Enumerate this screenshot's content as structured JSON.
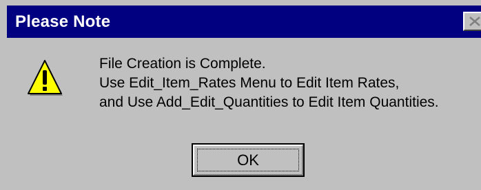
{
  "dialog": {
    "title": "Please Note",
    "message_lines": [
      "File Creation is Complete.",
      "Use Edit_Item_Rates Menu to Edit Item Rates,",
      "and Use Add_Edit_Quantities to Edit Item Quantities."
    ],
    "ok_label": "OK",
    "icon": "warning-icon",
    "close_icon": "close-icon"
  },
  "colors": {
    "titlebar": "#000080",
    "face": "#c0c0c0",
    "warning_fill": "#ffff00"
  }
}
